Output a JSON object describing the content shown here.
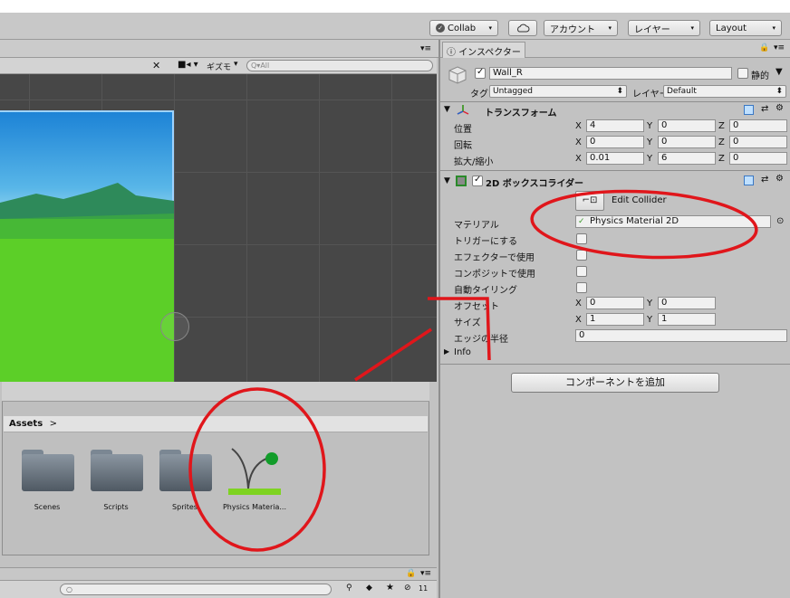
{
  "toolbar": {
    "collab": "Collab",
    "account": "アカウント",
    "layers": "レイヤー",
    "layout": "Layout",
    "arrow": "▾"
  },
  "scene": {
    "gizmos": "ギズモ",
    "search_placeholder": "Q▾All"
  },
  "project": {
    "breadcrumb": "Assets",
    "breadcrumb_arrow": ">",
    "assets": [
      {
        "name": "Scenes"
      },
      {
        "name": "Scripts"
      },
      {
        "name": "Sprites"
      },
      {
        "name": "Physics Materia..."
      }
    ],
    "count_badge": "11"
  },
  "inspector": {
    "tab": "インスペクター",
    "object_name": "Wall_R",
    "static_label": "静的",
    "tag_label": "タグ",
    "tag_value": "Untagged",
    "layer_label": "レイヤー",
    "layer_value": "Default",
    "transform": {
      "title": "トランスフォーム",
      "position_label": "位置",
      "rotation_label": "回転",
      "scale_label": "拡大/縮小",
      "position": {
        "x": "4",
        "y": "0",
        "z": "0"
      },
      "rotation": {
        "x": "0",
        "y": "0",
        "z": "0"
      },
      "scale": {
        "x": "0.01",
        "y": "6",
        "z": "0"
      }
    },
    "box_collider": {
      "title": "2D ボックスコライダー",
      "edit_collider": "Edit Collider",
      "material_label": "マテリアル",
      "material_value": "Physics Material 2D",
      "trigger_label": "トリガーにする",
      "effector_label": "エフェクターで使用",
      "composite_label": "コンポジットで使用",
      "autotiling_label": "自動タイリング",
      "offset_label": "オフセット",
      "size_label": "サイズ",
      "edge_radius_label": "エッジの半径",
      "info_label": "Info",
      "offset": {
        "x": "0",
        "y": "0"
      },
      "size": {
        "x": "1",
        "y": "1"
      },
      "edge_radius": "0"
    },
    "add_component": "コンポーネントを追加"
  },
  "axis": {
    "x": "X",
    "y": "Y",
    "z": "Z"
  },
  "colors": {
    "annotation_red": "#e0161b",
    "accent_green": "#7ed321"
  }
}
